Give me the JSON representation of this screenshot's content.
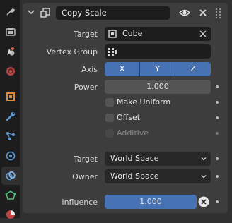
{
  "sidebar": {
    "tabs": [
      {
        "name": "tool-icon",
        "active": false
      },
      {
        "name": "render-icon",
        "active": false
      },
      {
        "name": "output-icon",
        "active": false
      },
      {
        "name": "view-layer-icon",
        "active": false
      },
      {
        "name": "scene-icon",
        "active": false
      },
      {
        "name": "world-icon",
        "active": false
      },
      {
        "name": "object-icon",
        "active": false
      },
      {
        "name": "modifier-wrench-icon",
        "active": false
      },
      {
        "name": "particles-icon",
        "active": false
      },
      {
        "name": "physics-icon",
        "active": false
      },
      {
        "name": "constraints-icon",
        "active": true
      },
      {
        "name": "data-icon",
        "active": false
      },
      {
        "name": "material-icon",
        "active": false
      }
    ]
  },
  "constraint": {
    "name": "Copy Scale",
    "header_icons": [
      "chevron-down-icon",
      "copy-scale-constraint-icon",
      "eye-icon",
      "close-icon",
      "drag-grip-icon"
    ],
    "target_label": "Target",
    "target_value": "Cube",
    "vertex_group_label": "Vertex Group",
    "axis_label": "Axis",
    "axis": [
      {
        "label": "X",
        "enabled": true
      },
      {
        "label": "Y",
        "enabled": true
      },
      {
        "label": "Z",
        "enabled": true
      }
    ],
    "power_label": "Power",
    "power_value": "1.000",
    "make_uniform_label": "Make Uniform",
    "offset_label": "Offset",
    "additive_label": "Additive",
    "target_space_label": "Target",
    "target_space_value": "World Space",
    "owner_space_label": "Owner",
    "owner_space_value": "World Space",
    "influence_label": "Influence",
    "influence_value": "1.000",
    "influence_fraction": 1.0
  },
  "colors": {
    "accent": "#4772b3",
    "panel": "#3d3d3d",
    "field": "#1d1d1d"
  }
}
